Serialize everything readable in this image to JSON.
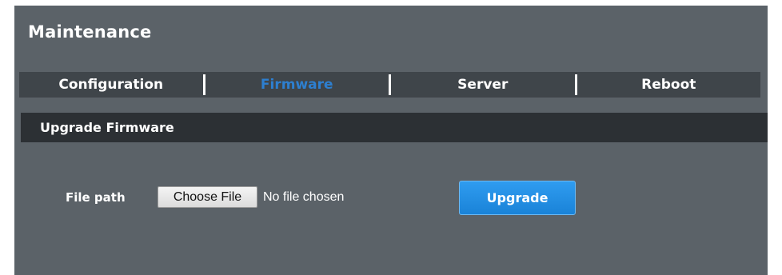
{
  "page": {
    "title": "Maintenance"
  },
  "tabs": [
    {
      "label": "Configuration",
      "active": false
    },
    {
      "label": "Firmware",
      "active": true
    },
    {
      "label": "Server",
      "active": false
    },
    {
      "label": "Reboot",
      "active": false
    }
  ],
  "section": {
    "title": "Upgrade Firmware"
  },
  "form": {
    "file_path_label": "File path",
    "choose_file_label": "Choose File",
    "no_file_text": "No file chosen",
    "upgrade_label": "Upgrade"
  },
  "colors": {
    "panel_bg": "#5b6268",
    "tabbar_bg": "#3f454a",
    "section_bg": "#2c3034",
    "active_tab_text": "#2d7fd0",
    "upgrade_button": "#1f8ee4"
  }
}
